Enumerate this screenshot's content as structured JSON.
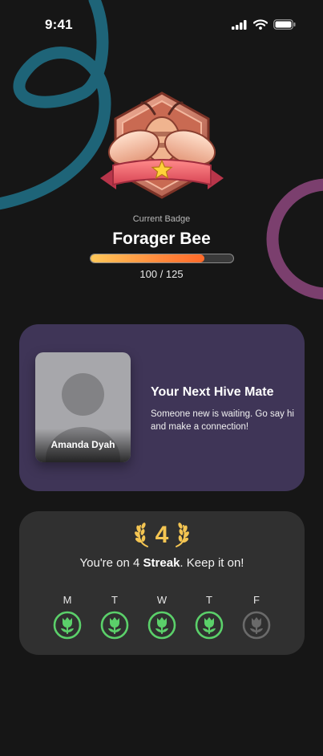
{
  "status_bar": {
    "time": "9:41"
  },
  "badge": {
    "caption": "Current Badge",
    "name": "Forager Bee",
    "progress_current": 100,
    "progress_total": 125,
    "progress_text": "100 / 125"
  },
  "hive_mate": {
    "name": "Amanda Dyah",
    "title": "Your Next Hive Mate",
    "description": "Someone new is waiting. Go say hi and make a connection!"
  },
  "streak": {
    "count": "4",
    "text_prefix": "You're on 4 ",
    "text_bold": "Streak",
    "text_suffix": ". Keep it on!",
    "days": [
      {
        "label": "M",
        "done": true
      },
      {
        "label": "T",
        "done": true
      },
      {
        "label": "W",
        "done": true
      },
      {
        "label": "T",
        "done": true
      },
      {
        "label": "F",
        "done": false
      }
    ]
  },
  "colors": {
    "background": "#161616",
    "mate_card": "#3f3557",
    "streak_card": "#303030",
    "accent_gold": "#f4c552",
    "done_green": "#5bd06a",
    "pending_gray": "#6a6a6a",
    "deco_teal": "#1e6478",
    "deco_purple": "#7b3f6e"
  },
  "icons": {
    "signal": "cellular-signal-icon",
    "wifi": "wifi-icon",
    "battery": "battery-icon",
    "streak_laurel": "laurel-icon",
    "day_done": "tulip-icon"
  }
}
